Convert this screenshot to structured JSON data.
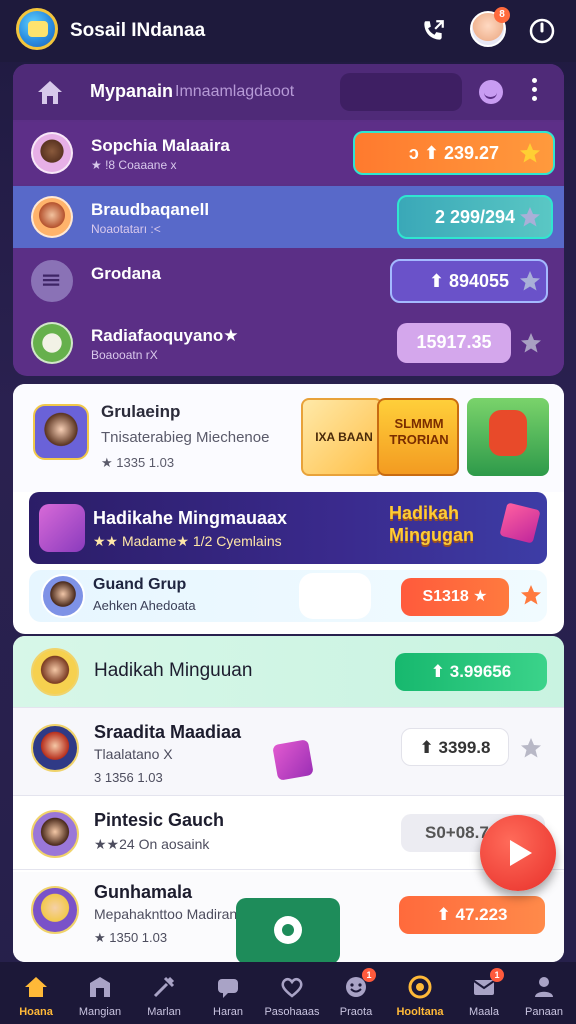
{
  "app": {
    "title": "Sosail INdanaa"
  },
  "topbar": {
    "avatar_badge": "8"
  },
  "leaderboard": {
    "title": "Mypanain",
    "subtitle": "Imnaamlagdaoot",
    "rows": [
      {
        "name": "Sopchia Malaaira",
        "meta": "★ !8 Coaaane x",
        "score": "ↄ  ⬆ 239.27",
        "star_color": "#ffcf33"
      },
      {
        "name": "Braudbaqanell",
        "meta": "Noaotatarı :<",
        "score": "2  299/294",
        "star_color": "#a9b0d8"
      },
      {
        "name": "Grodana",
        "meta": "",
        "score": "⬆ 894055",
        "star_color": "#a9b0d8"
      },
      {
        "name": "Radiafaoquyano★",
        "meta": "Boaooatn rX",
        "score": "15917.35",
        "star_color": "#a9a0c2"
      }
    ]
  },
  "groups": {
    "card": {
      "title": "Grulaeinp",
      "subtitle": "Tnisaterabieg Miechenoe",
      "count": "★ 1335 1.03"
    },
    "thumbs": [
      {
        "label": "IXA BAAN"
      },
      {
        "label": "SLMMM TRORIAN"
      },
      {
        "label": ""
      }
    ],
    "banner": {
      "title": "Hadikahe Mingmauaax",
      "meta": "★★ Madame★  1/2 Cyemlains",
      "art": "Hadikah Mingugan"
    },
    "join": {
      "title": "Guand Grup",
      "subtitle": "Aehken Ahedoata",
      "score": "S1318 ★"
    }
  },
  "list": {
    "items": [
      {
        "name": "Hadikah Minguuan",
        "meta": "",
        "count": "",
        "score": "⬆ 3.99656"
      },
      {
        "name": "Sraadita Maadiaa",
        "meta": "Tlaalatano X",
        "count": "3 1356 1.03",
        "score": "⬆ 3399.8"
      },
      {
        "name": "Pintesic Gauch",
        "meta": "★★24 On aosaink",
        "count": "",
        "score": "S0+08.7"
      },
      {
        "name": "Gunhamala",
        "meta": "Mepahaknttoo Madiran",
        "count": "★ 1350 1.03",
        "score": "⬆ 47.223"
      }
    ]
  },
  "nav": {
    "items": [
      {
        "label": "Hoana",
        "badge": ""
      },
      {
        "label": "Mangian",
        "badge": ""
      },
      {
        "label": "Marlan",
        "badge": ""
      },
      {
        "label": "Haran",
        "badge": ""
      },
      {
        "label": "Pasohaaas",
        "badge": ""
      },
      {
        "label": "Praota",
        "badge": "1"
      },
      {
        "label": "Hooltana",
        "badge": ""
      },
      {
        "label": "Maala",
        "badge": "1"
      },
      {
        "label": "Panaan",
        "badge": ""
      }
    ]
  },
  "colors": {
    "accent": "#ffb938",
    "leaderboard_bg": "#5b2f86",
    "highlight_row": "#5869c9",
    "fab": "#e8302a",
    "green": "#1e8c5a"
  }
}
